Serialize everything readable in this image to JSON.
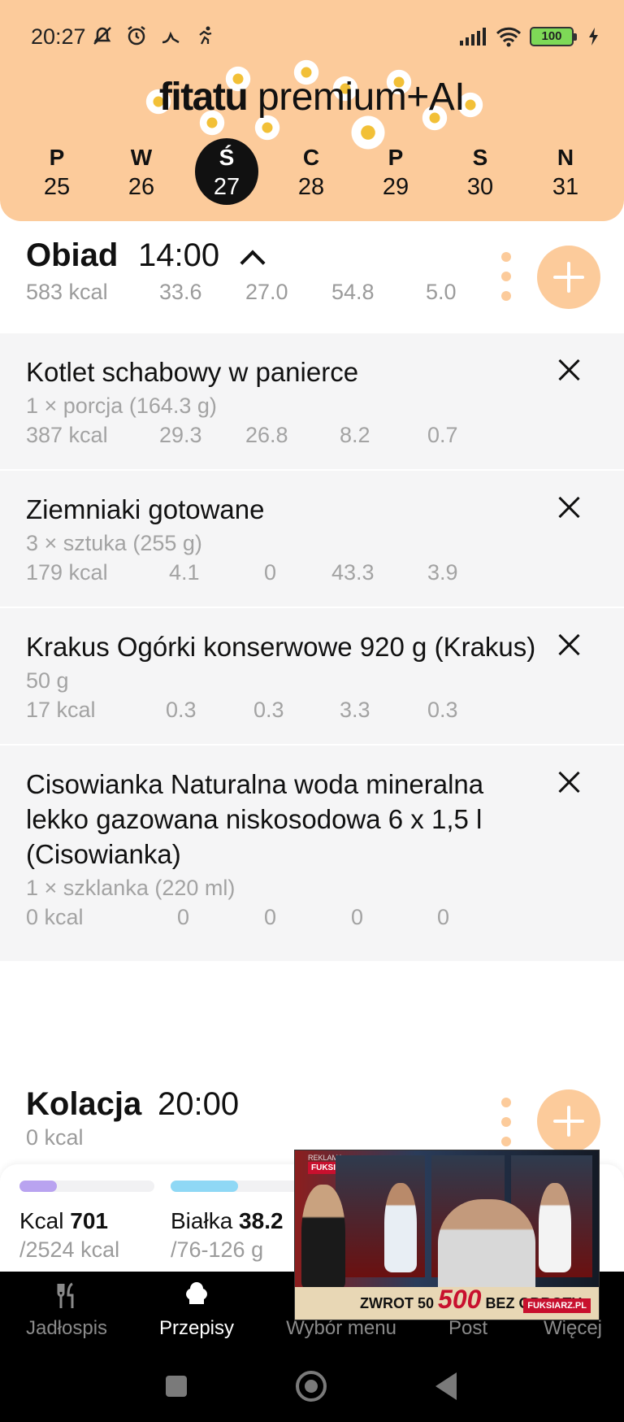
{
  "status_bar": {
    "time": "20:27",
    "battery": "100"
  },
  "app": {
    "logo_main": "fitatu",
    "logo_suffix": " premium+AI"
  },
  "week": [
    {
      "letter": "P",
      "num": "25",
      "active": false
    },
    {
      "letter": "W",
      "num": "26",
      "active": false
    },
    {
      "letter": "Ś",
      "num": "27",
      "active": true
    },
    {
      "letter": "C",
      "num": "28",
      "active": false
    },
    {
      "letter": "P",
      "num": "29",
      "active": false
    },
    {
      "letter": "S",
      "num": "30",
      "active": false
    },
    {
      "letter": "N",
      "num": "31",
      "active": false
    }
  ],
  "lunch": {
    "title": "Obiad",
    "time": "14:00",
    "kcal": "583 kcal",
    "macros": [
      "33.6",
      "27.0",
      "54.8",
      "5.0"
    ],
    "items": [
      {
        "name": "Kotlet schabowy w panierce",
        "portion": "1 × porcja (164.3 g)",
        "kcal": "387 kcal",
        "macros": [
          "29.3",
          "26.8",
          "8.2",
          "0.7"
        ]
      },
      {
        "name": "Ziemniaki gotowane",
        "portion": "3 × sztuka (255 g)",
        "kcal": "179 kcal",
        "macros": [
          "4.1",
          "0",
          "43.3",
          "3.9"
        ]
      },
      {
        "name": "Krakus Ogórki konserwowe 920 g (Krakus)",
        "portion": "50 g",
        "kcal": "17 kcal",
        "macros": [
          "0.3",
          "0.3",
          "3.3",
          "0.3"
        ]
      },
      {
        "name": "Cisowianka Naturalna woda mineralna lekko gazowana niskosodowa 6 x 1,5 l (Cisowianka)",
        "portion": "1 × szklanka (220 ml)",
        "kcal": "0 kcal",
        "macros": [
          "0",
          "0",
          "0",
          "0"
        ]
      }
    ]
  },
  "dinner": {
    "title": "Kolacja",
    "time": "20:00",
    "kcal": "0 kcal"
  },
  "summary": {
    "kcal_label": "Kcal",
    "kcal_value": "701",
    "kcal_goal": "/2524 kcal",
    "kcal_progress": 0.28,
    "kcal_color": "#b9a3f0",
    "protein_label": "Białka",
    "protein_value": "38.2",
    "protein_goal": "/76-126 g",
    "protein_progress": 0.5,
    "protein_color": "#8fd8f5"
  },
  "nav": [
    {
      "label": "Jadłospis",
      "icon": "fork-knife-icon",
      "active": false
    },
    {
      "label": "Przepisy",
      "icon": "chef-hat-icon",
      "active": true
    },
    {
      "label": "Wybór menu",
      "icon": "menu-icon",
      "active": false
    },
    {
      "label": "Post",
      "icon": "clock-icon",
      "active": false
    },
    {
      "label": "Więcej",
      "icon": "more-icon",
      "active": false
    }
  ],
  "ad": {
    "label": "REKLAMA",
    "brand": "FUKSIARZ.PL",
    "promo_left": "ZWROT 50",
    "promo_big": "500",
    "promo_right": "BEZ OBROTU"
  },
  "colors": {
    "header": "#fccb9b",
    "accent": "#fccb9b"
  }
}
